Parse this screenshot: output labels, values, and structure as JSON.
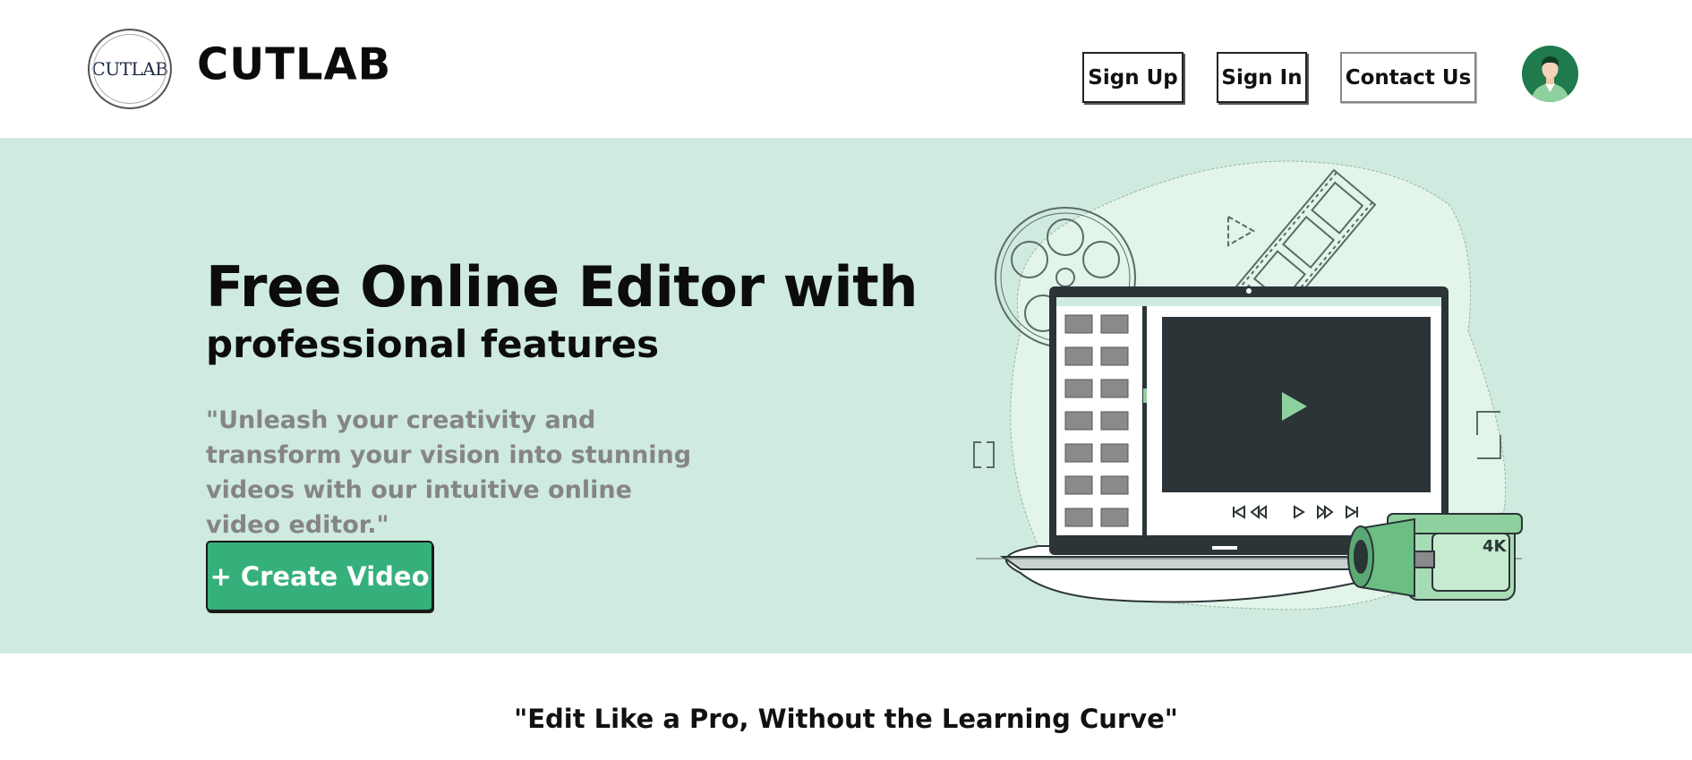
{
  "header": {
    "logo_text": "CUTLAB",
    "brand": "CUTLAB",
    "nav": {
      "signup": "Sign Up",
      "signin": "Sign In",
      "contact": "Contact Us"
    },
    "avatar_icon": "user-avatar-icon"
  },
  "hero": {
    "title": "Free Online Editor with",
    "subtitle": "professional features",
    "description": "\"Unleash your creativity and transform your vision into stunning videos with our intuitive online video editor.\"",
    "cta": "+ Create Video",
    "illustration": {
      "badge": "4K",
      "icons": [
        "film-reel-icon",
        "film-strip-icon",
        "laptop-icon",
        "play-icon",
        "camcorder-icon"
      ]
    }
  },
  "tagline": "\"Edit Like a Pro, Without the Learning Curve\"",
  "colors": {
    "hero_bg": "#cfeadf",
    "accent": "#36b07b",
    "muted_text": "#858585"
  }
}
